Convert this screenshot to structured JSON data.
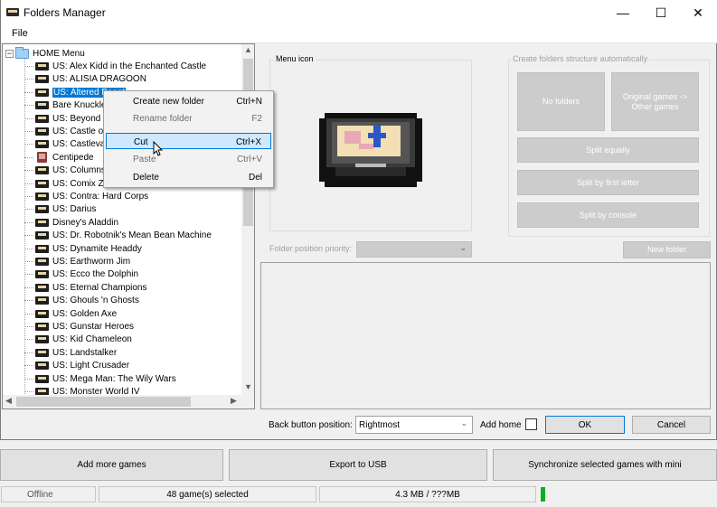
{
  "window": {
    "title": "Folders Manager",
    "minimize": "—",
    "maximize": "☐",
    "close": "✕"
  },
  "menubar": {
    "file": "File"
  },
  "tree": {
    "root": "HOME Menu",
    "items": [
      "US: Alex Kidd in the Enchanted Castle",
      "US: ALISIA DRAGOON",
      "US: Altered Beast",
      "Bare Knuckle",
      "US: Beyond O",
      "US: Castle of",
      "US: Castlevan",
      "Centipede",
      "US: Columns",
      "US: Comix Zo",
      "US: Contra: Hard Corps",
      "US: Darius",
      "Disney's Aladdin",
      "US: Dr. Robotnik's Mean Bean Machine",
      "US: Dynamite Headdy",
      "US: Earthworm Jim",
      "US: Ecco the Dolphin",
      "US: Eternal Champions",
      "US: Ghouls 'n Ghosts",
      "US: Golden Axe",
      "US: Gunstar Heroes",
      "US: Kid Chameleon",
      "US: Landstalker",
      "US: Light Crusader",
      "US: Mega Man: The Wily Wars",
      "US: Monster World IV"
    ],
    "selected_index": 2,
    "red_icon_index": 7
  },
  "context_menu": [
    {
      "label": "Create new folder",
      "shortcut": "Ctrl+N",
      "enabled": true
    },
    {
      "label": "Rename folder",
      "shortcut": "F2",
      "enabled": false
    },
    {
      "label": "Cut",
      "shortcut": "Ctrl+X",
      "enabled": true,
      "highlighted": true
    },
    {
      "label": "Paste",
      "shortcut": "Ctrl+V",
      "enabled": false
    },
    {
      "label": "Delete",
      "shortcut": "Del",
      "enabled": true
    }
  ],
  "menu_icon_group": {
    "label": "Menu icon"
  },
  "auto_group": {
    "label": "Create folders structure automatically",
    "no_folders": "No folders",
    "original_games_1": "Original games ->",
    "original_games_2": "Other games",
    "split_equally": "Split equally",
    "split_first_letter": "Split by first letter",
    "split_console": "Split by console"
  },
  "folder_priority": {
    "label": "Folder position priority:",
    "value": ""
  },
  "new_folder": "New folder",
  "bottom": {
    "back_label": "Back button position:",
    "back_value": "Rightmost",
    "add_home": "Add home",
    "ok": "OK",
    "cancel": "Cancel"
  },
  "parent": {
    "add_more_games": "Add more games",
    "export_usb": "Export to USB",
    "sync": "Synchronize selected games with mini"
  },
  "status": {
    "offline": "Offline",
    "selected": "48 game(s) selected",
    "size": "4.3 MB / ???MB",
    "progress": 0.01
  },
  "colors": {
    "selection": "#0078d7",
    "progress": "#06b025",
    "highlight": "#cde8ff"
  }
}
